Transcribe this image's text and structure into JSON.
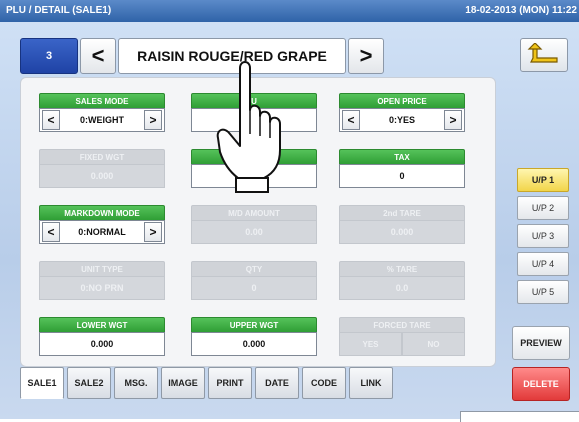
{
  "title_bar": {
    "title": "PLU / DETAIL (SALE1)",
    "datetime": "18-02-2013 (MON) 11:22"
  },
  "header": {
    "plu_number": "3",
    "prev_icon": "<",
    "next_icon": ">",
    "item_name": "RAISIN ROUGE/RED GRAPE",
    "back_icon": "return-arrow-icon"
  },
  "fields": {
    "sales_mode": {
      "label": "SALES MODE",
      "value": "0:WEIGHT"
    },
    "unit_price": {
      "label": "U",
      "value": ""
    },
    "open_price": {
      "label": "OPEN PRICE",
      "value": "0:YES"
    },
    "fixed_wgt": {
      "label": "FIXED WGT",
      "value": "0.000"
    },
    "middle_field": {
      "label": "",
      "value": ""
    },
    "tax": {
      "label": "TAX",
      "value": "0"
    },
    "markdown_mode": {
      "label": "MARKDOWN MODE",
      "value": "0:NORMAL"
    },
    "md_amount": {
      "label": "M/D AMOUNT",
      "value": "0.00"
    },
    "second_tare": {
      "label": "2nd TARE",
      "value": "0.000"
    },
    "unit_type": {
      "label": "UNIT TYPE",
      "value": "0:NO PRN"
    },
    "qty": {
      "label": "QTY",
      "value": "0"
    },
    "pct_tare": {
      "label": "% TARE",
      "value": "0.0"
    },
    "lower_wgt": {
      "label": "LOWER WGT",
      "value": "0.000"
    },
    "upper_wgt": {
      "label": "UPPER WGT",
      "value": "0.000"
    },
    "forced_tare": {
      "label": "FORCED TARE",
      "yes": "YES",
      "no": "NO"
    }
  },
  "up_buttons": [
    "U/P 1",
    "U/P 2",
    "U/P 3",
    "U/P 4",
    "U/P 5"
  ],
  "actions": {
    "preview": "PREVIEW",
    "delete": "DELETE"
  },
  "tabs": [
    "SALE1",
    "SALE2",
    "MSG.",
    "IMAGE",
    "PRINT",
    "DATE",
    "CODE",
    "LINK"
  ],
  "colors": {
    "accent_green": "#3aaa3f",
    "title_blue": "#2f63a8",
    "active_yellow": "#f2d54a",
    "delete_red": "#e23a3a"
  }
}
